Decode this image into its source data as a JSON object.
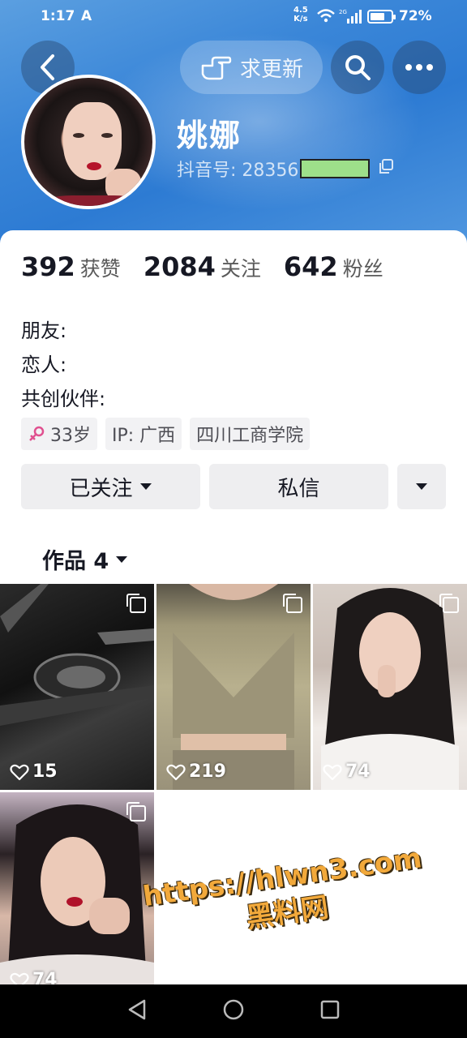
{
  "status_bar": {
    "time": "1:17",
    "indicator": "A",
    "net_speed_top": "4.5",
    "net_speed_bottom": "K/s",
    "network": "2G",
    "battery_pct": "72%",
    "battery_level": 0.72
  },
  "header": {
    "update_request_label": "求更新",
    "name": "姚娜",
    "douyin_id_prefix": "抖音号: 28356"
  },
  "stats": [
    {
      "value": "392",
      "label": "获赞"
    },
    {
      "value": "2084",
      "label": "关注"
    },
    {
      "value": "642",
      "label": "粉丝"
    }
  ],
  "relations": [
    {
      "label": "朋友:"
    },
    {
      "label": "恋人:"
    },
    {
      "label": "共创伙伴:"
    }
  ],
  "tags": {
    "age": "33岁",
    "ip": "IP: 广西",
    "school": "四川工商学院"
  },
  "actions": {
    "follow_label": "已关注",
    "message_label": "私信"
  },
  "works": {
    "label": "作品 4",
    "items": [
      {
        "likes": "15"
      },
      {
        "likes": "219"
      },
      {
        "likes": "74"
      },
      {
        "likes": "74"
      }
    ]
  },
  "watermark": {
    "line1": "https://hlwn3.com",
    "line2": "黑料网"
  },
  "colors": {
    "header_blue": "#3a86d8",
    "gender_pink": "#e0508f",
    "mask_green": "#9ee08a"
  }
}
